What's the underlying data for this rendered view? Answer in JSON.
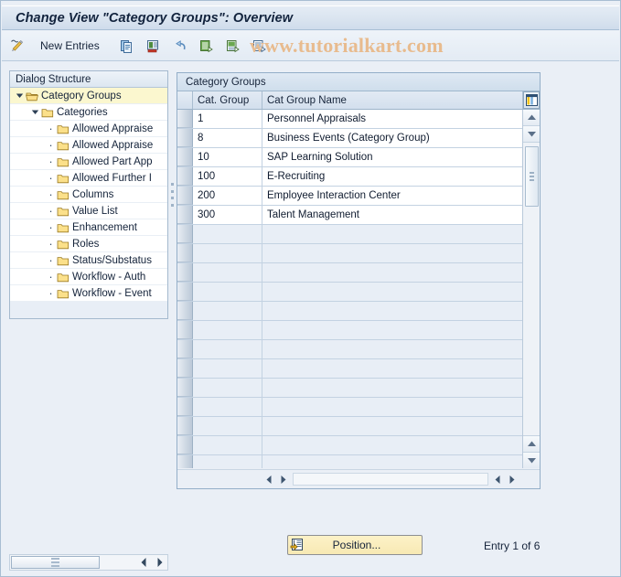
{
  "window": {
    "title": "Change View \"Category Groups\": Overview"
  },
  "watermark": {
    "text": "www.tutorialkart.com"
  },
  "toolbar": {
    "new_entries_label": "New Entries",
    "items": [
      {
        "name": "pencil-change-icon",
        "tooltip": "Display/Change"
      },
      {
        "name": "new-entries-button",
        "label": "New Entries"
      },
      {
        "name": "copy-as-icon",
        "tooltip": "Copy As..."
      },
      {
        "name": "delete-icon",
        "tooltip": "Delete"
      },
      {
        "name": "undo-icon",
        "tooltip": "Undo Change"
      },
      {
        "name": "select-all-icon",
        "tooltip": "Select All"
      },
      {
        "name": "deselect-all-icon",
        "tooltip": "Deselect All"
      },
      {
        "name": "select-block-icon",
        "tooltip": "Select Block"
      }
    ]
  },
  "sidebar": {
    "header": "Dialog Structure",
    "items": [
      {
        "label": "Category Groups",
        "level": 0,
        "expanded": true,
        "selected": true
      },
      {
        "label": "Categories",
        "level": 1,
        "expanded": true,
        "selected": false
      },
      {
        "label": "Allowed Appraise",
        "level": 2,
        "expanded": false,
        "selected": false
      },
      {
        "label": "Allowed Appraise",
        "level": 2,
        "expanded": false,
        "selected": false
      },
      {
        "label": "Allowed Part App",
        "level": 2,
        "expanded": false,
        "selected": false
      },
      {
        "label": "Allowed Further I",
        "level": 2,
        "expanded": false,
        "selected": false
      },
      {
        "label": "Columns",
        "level": 2,
        "expanded": false,
        "selected": false
      },
      {
        "label": "Value List",
        "level": 2,
        "expanded": false,
        "selected": false
      },
      {
        "label": "Enhancement",
        "level": 2,
        "expanded": false,
        "selected": false
      },
      {
        "label": "Roles",
        "level": 2,
        "expanded": false,
        "selected": false
      },
      {
        "label": "Status/Substatus",
        "level": 2,
        "expanded": false,
        "selected": false
      },
      {
        "label": "Workflow - Auth",
        "level": 2,
        "expanded": false,
        "selected": false
      },
      {
        "label": "Workflow - Event",
        "level": 2,
        "expanded": false,
        "selected": false
      }
    ]
  },
  "table": {
    "caption": "Category Groups",
    "columns": [
      "Cat. Group",
      "Cat Group Name"
    ],
    "rows": [
      {
        "cat_group": "1",
        "cat_group_name": "Personnel Appraisals"
      },
      {
        "cat_group": "8",
        "cat_group_name": "Business Events (Category Group)"
      },
      {
        "cat_group": "10",
        "cat_group_name": "SAP Learning Solution"
      },
      {
        "cat_group": "100",
        "cat_group_name": "E-Recruiting"
      },
      {
        "cat_group": "200",
        "cat_group_name": "Employee Interaction Center"
      },
      {
        "cat_group": "300",
        "cat_group_name": "Talent Management"
      }
    ],
    "empty_row_count": 13
  },
  "footer": {
    "position_button_label": "Position...",
    "entry_status": "Entry 1 of 6"
  },
  "colors": {
    "accent": "#f7e9b4",
    "panel_border": "#93aec8",
    "watermark": "#e8bb8e",
    "selection": "#fbf7cf"
  }
}
